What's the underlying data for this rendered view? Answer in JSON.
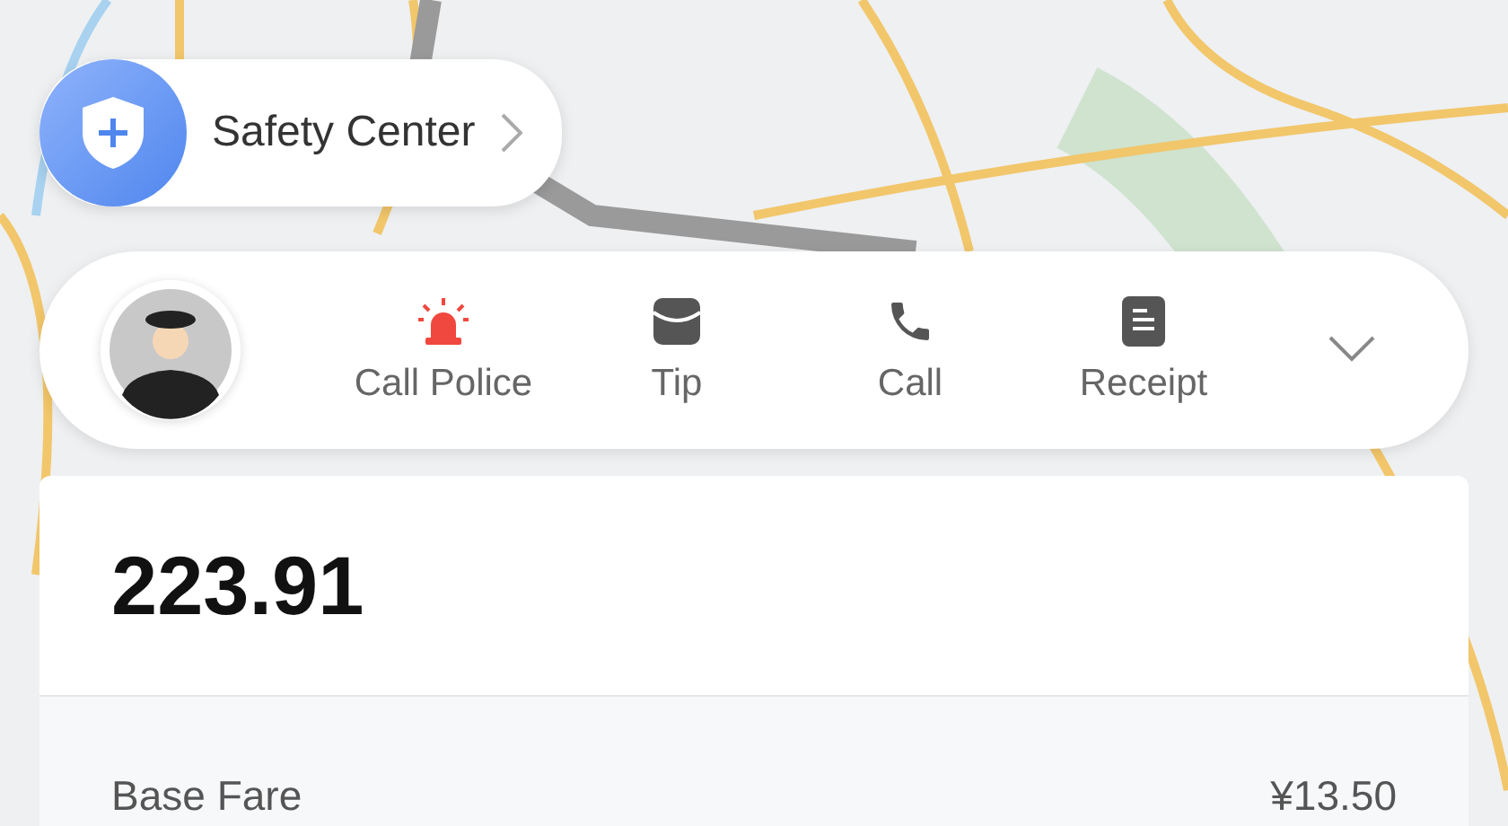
{
  "safety_center": {
    "label": "Safety Center"
  },
  "actions": [
    {
      "kind": "police",
      "label": "Call Police"
    },
    {
      "kind": "tip",
      "label": "Tip"
    },
    {
      "kind": "call",
      "label": "Call"
    },
    {
      "kind": "receipt",
      "label": "Receipt"
    }
  ],
  "fare": {
    "total": "223.91",
    "items": [
      {
        "label": "Base Fare",
        "amount": "¥13.50"
      }
    ]
  }
}
